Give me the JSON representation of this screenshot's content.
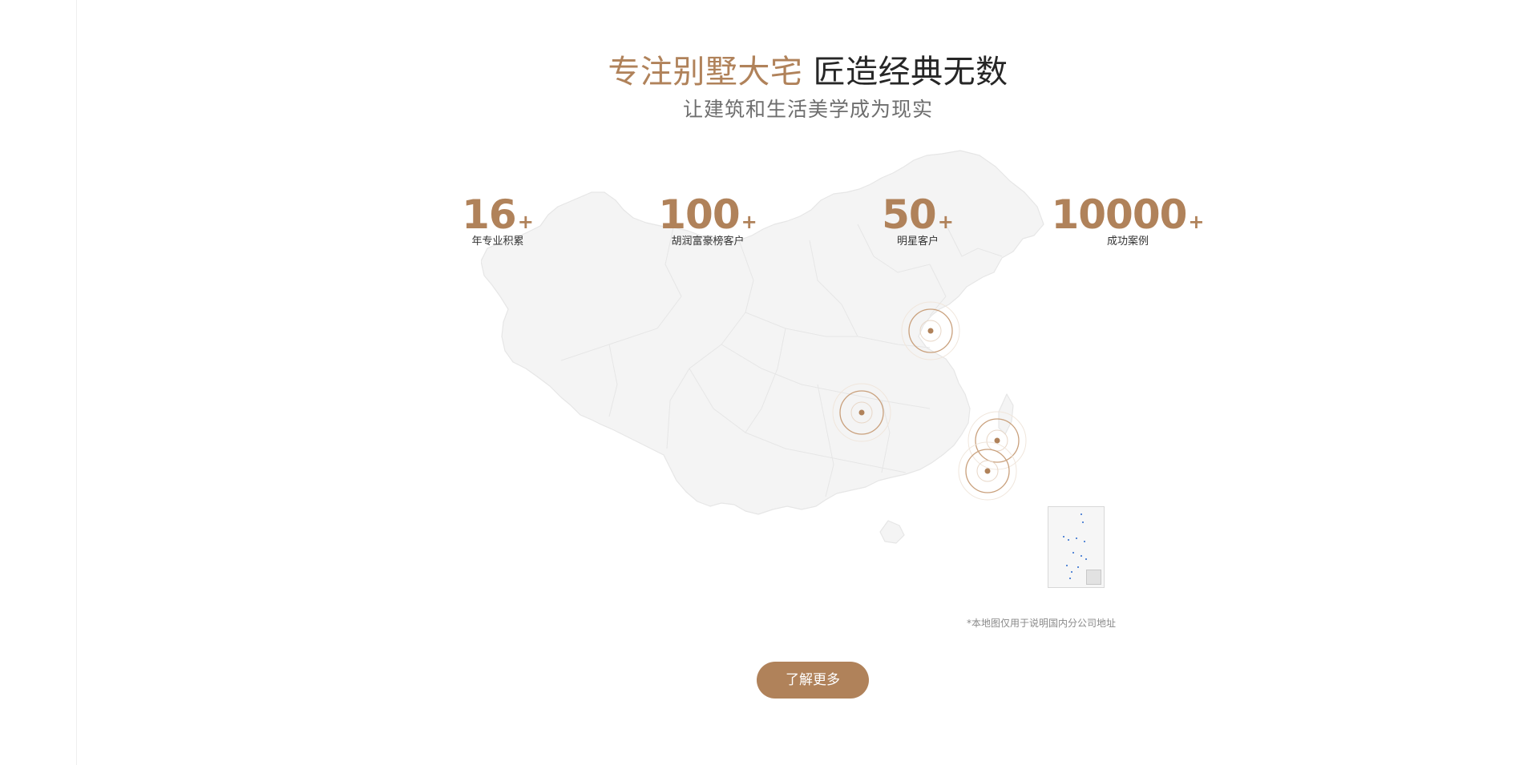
{
  "headline": {
    "accent": "专注别墅大宅",
    "dark": "匠造经典无数"
  },
  "subline": "让建筑和生活美学成为现实",
  "stats": [
    {
      "number": "16",
      "plus": "+",
      "label": "年专业积累"
    },
    {
      "number": "100",
      "plus": "+",
      "label": "胡润富豪榜客户"
    },
    {
      "number": "50",
      "plus": "+",
      "label": "明星客户"
    },
    {
      "number": "10000",
      "plus": "+",
      "label": "成功案例"
    }
  ],
  "map_note": "*本地图仅用于说明国内分公司地址",
  "more_button": "了解更多",
  "colors": {
    "accent": "#b0825a",
    "map_fill": "#f4f4f4",
    "map_border": "#e6e6e6",
    "text_dark": "#262626",
    "text_muted": "#6e6e6e"
  }
}
